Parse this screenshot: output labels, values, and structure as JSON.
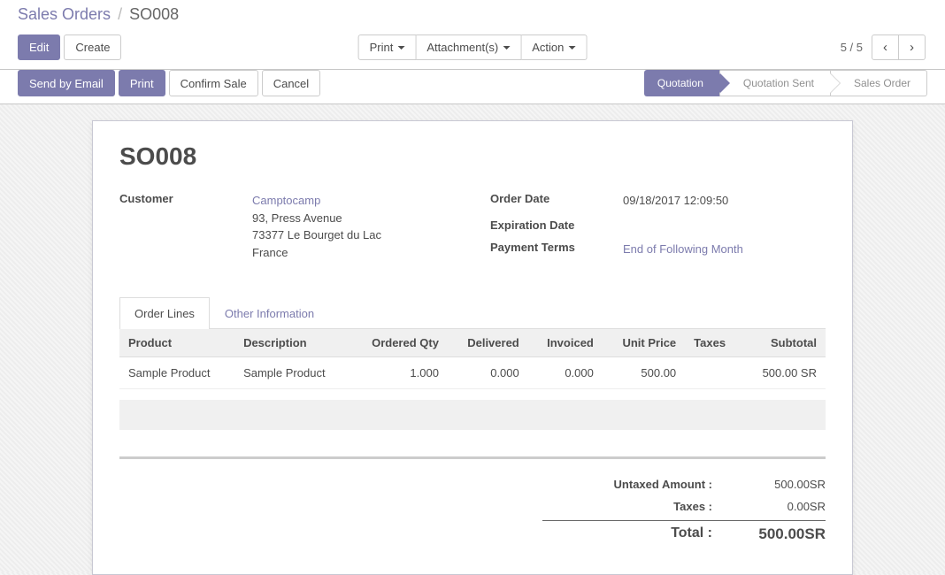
{
  "breadcrumb": {
    "root": "Sales Orders",
    "current": "SO008"
  },
  "buttons": {
    "edit": "Edit",
    "create": "Create",
    "print_dd": "Print",
    "attachments_dd": "Attachment(s)",
    "action_dd": "Action",
    "send_email": "Send by Email",
    "print": "Print",
    "confirm": "Confirm Sale",
    "cancel": "Cancel"
  },
  "pager": {
    "text": "5 / 5",
    "prev_glyph": "‹",
    "next_glyph": "›"
  },
  "status_steps": [
    "Quotation",
    "Quotation Sent",
    "Sales Order"
  ],
  "active_step": 0,
  "record": {
    "name": "SO008",
    "labels": {
      "customer": "Customer",
      "order_date": "Order Date",
      "expiration_date": "Expiration Date",
      "payment_terms": "Payment Terms"
    },
    "customer": {
      "name": "Camptocamp",
      "street": "93, Press Avenue",
      "city_line": "73377 Le Bourget du Lac",
      "country": "France"
    },
    "order_date": "09/18/2017 12:09:50",
    "expiration_date": "",
    "payment_terms": "End of Following Month"
  },
  "tabs": [
    "Order Lines",
    "Other Information"
  ],
  "active_tab": 0,
  "columns": [
    "Product",
    "Description",
    "Ordered Qty",
    "Delivered",
    "Invoiced",
    "Unit Price",
    "Taxes",
    "Subtotal"
  ],
  "lines": [
    {
      "product": "Sample Product",
      "description": "Sample Product",
      "ordered_qty": "1.000",
      "delivered": "0.000",
      "invoiced": "0.000",
      "unit_price": "500.00",
      "taxes": "",
      "subtotal": "500.00 SR"
    }
  ],
  "totals": {
    "untaxed_label": "Untaxed Amount :",
    "untaxed": "500.00SR",
    "taxes_label": "Taxes :",
    "taxes": "0.00SR",
    "total_label": "Total :",
    "total": "500.00SR"
  }
}
